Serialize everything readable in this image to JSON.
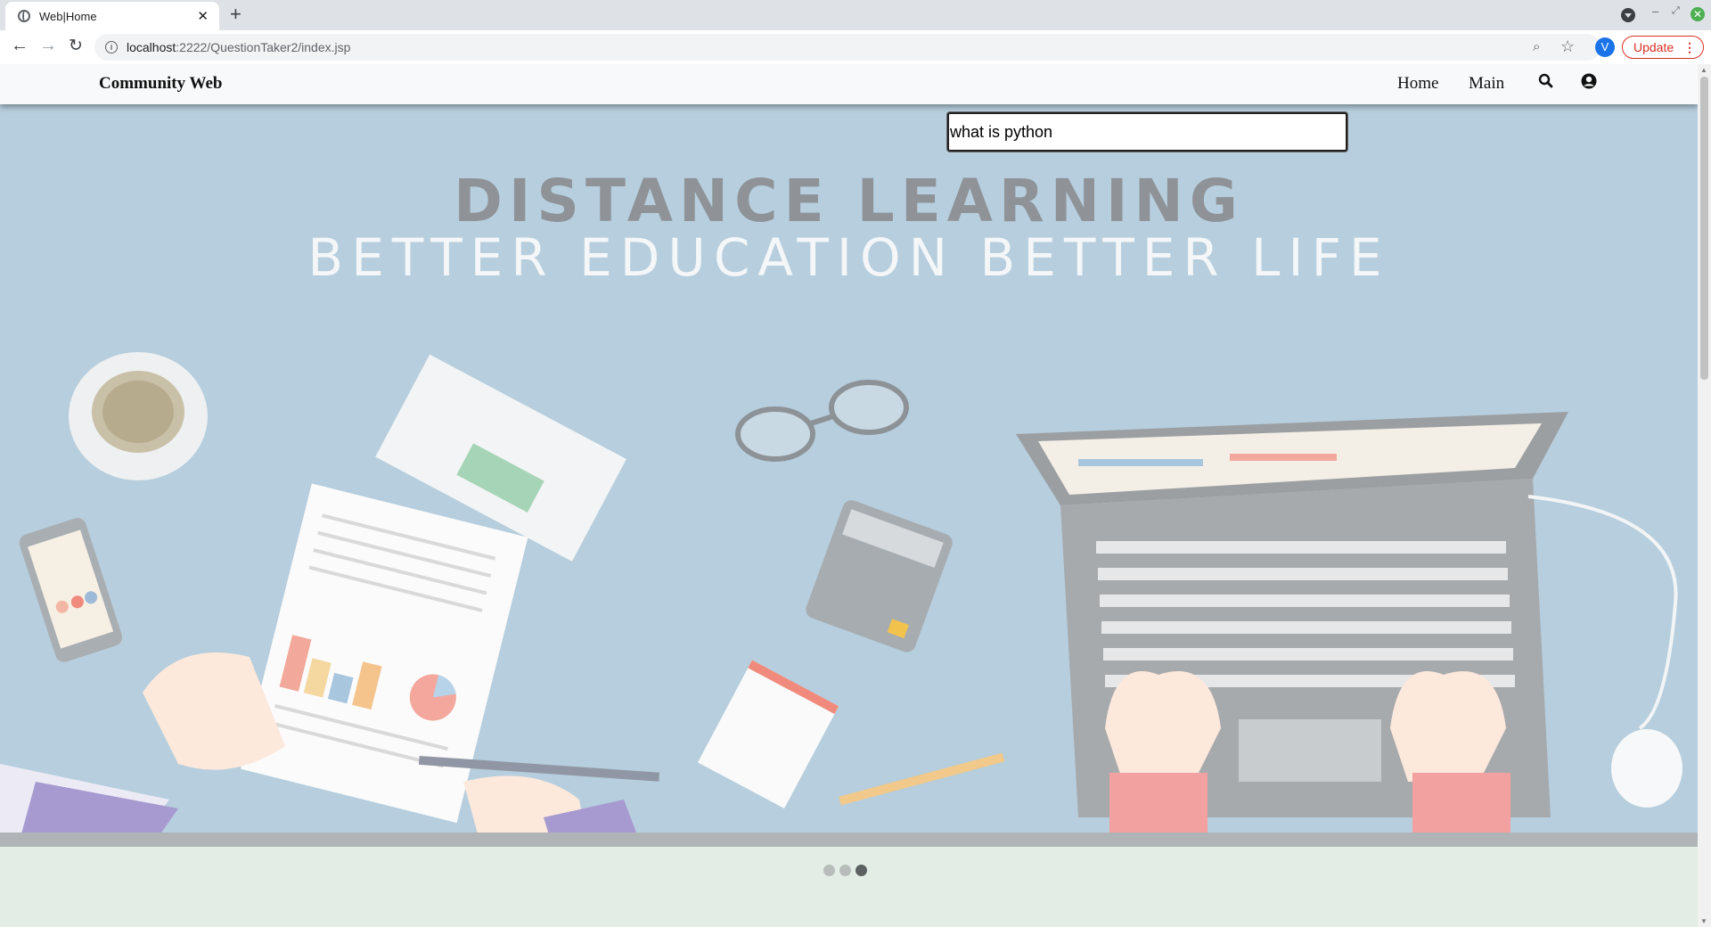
{
  "browser": {
    "tab_title": "Web|Home",
    "url_host": "localhost",
    "url_path": ":2222/QuestionTaker2/index.jsp",
    "profile_initial": "V",
    "update_label": "Update"
  },
  "site": {
    "brand": "Community Web",
    "nav": {
      "home": "Home",
      "main": "Main"
    },
    "search_value": "what is python"
  },
  "hero": {
    "title": "DISTANCE LEARNING",
    "subtitle": "BETTER EDUCATION BETTER LIFE",
    "background_color": "#b6cedd"
  },
  "carousel": {
    "slides": 3,
    "active_index": 3
  }
}
